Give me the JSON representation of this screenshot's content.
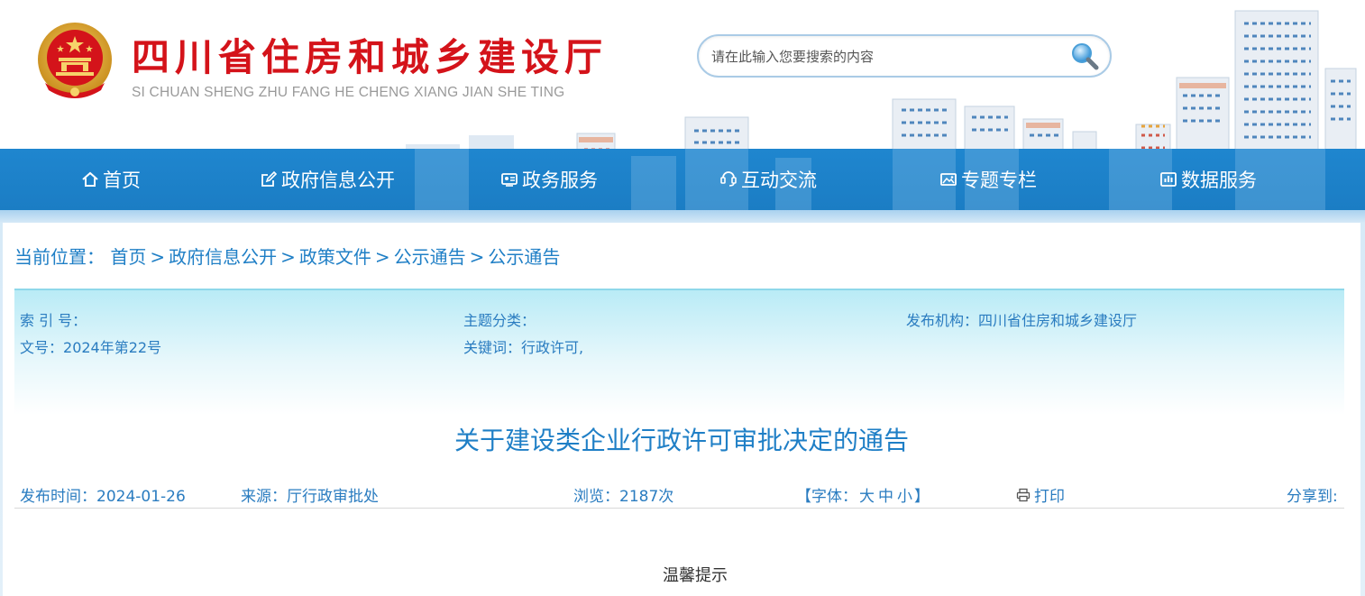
{
  "header": {
    "title": "四川省住房和城乡建设厅",
    "pinyin": "SI CHUAN SHENG ZHU FANG HE CHENG XIANG JIAN SHE TING",
    "emblem_icon": "national-emblem-icon",
    "title_color": "#d4131a"
  },
  "search": {
    "placeholder": "请在此输入您要搜索的内容",
    "value": "",
    "icon": "magnifier-icon"
  },
  "nav": {
    "background": "#1b7dc4",
    "items": [
      {
        "label": "首页",
        "icon": "home-icon"
      },
      {
        "label": "政府信息公开",
        "icon": "edit-icon"
      },
      {
        "label": "政务服务",
        "icon": "service-card-icon"
      },
      {
        "label": "互动交流",
        "icon": "interaction-icon"
      },
      {
        "label": "专题专栏",
        "icon": "image-icon"
      },
      {
        "label": "数据服务",
        "icon": "data-chart-icon"
      }
    ]
  },
  "breadcrumb": {
    "label": "当前位置：",
    "items": [
      "首页",
      "政府信息公开",
      "政策文件",
      "公示通告",
      "公示通告"
    ],
    "separator": ">"
  },
  "meta": {
    "index_label": "索 引 号：",
    "index_value": "",
    "topic_label": "主题分类：",
    "topic_value": "",
    "publisher_label": "发布机构：",
    "publisher_value": "四川省住房和城乡建设厅",
    "doc_no_label": "文号：",
    "doc_no_value": "2024年第22号",
    "keywords_label": "关键词：",
    "keywords_value": "行政许可,"
  },
  "article": {
    "title": "关于建设类企业行政许可审批决定的通告",
    "publish_time_label": "发布时间：",
    "publish_time": "2024-01-26",
    "source_label": "来源：",
    "source": "厅行政审批处",
    "views_label": "浏览：",
    "views": "2187次",
    "font_label": "【字体：",
    "font_large": "大",
    "font_medium": "中",
    "font_small": "小",
    "font_close": "】",
    "print_label": "打印",
    "print_icon": "printer-icon",
    "share_label": "分享到:",
    "tip": "温馨提示"
  },
  "colors": {
    "accent_blue": "#1f7fc6",
    "meta_text": "#2a7cc0"
  }
}
